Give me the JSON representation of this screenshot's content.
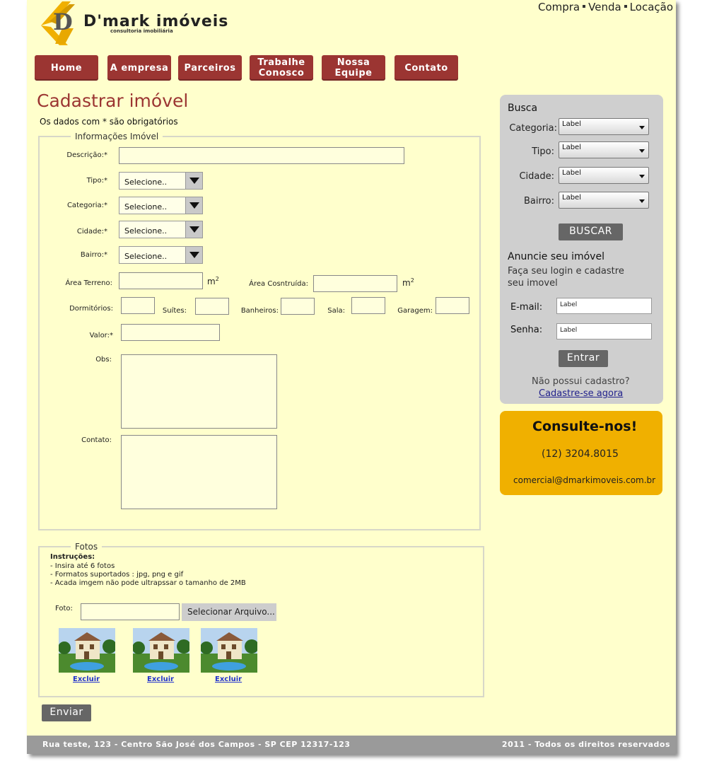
{
  "logo": {
    "name": "D'mark imóveis",
    "subtitle": "consultoria imobiliária"
  },
  "top_links": [
    "Compra",
    "Venda",
    "Locação"
  ],
  "nav": [
    "Home",
    "A empresa",
    "Parceiros",
    "Trabalhe Conosco",
    "Nossa Equipe",
    "Contato"
  ],
  "page_title": "Cadastrar imóvel",
  "required_note": "Os dados com * são obrigatórios",
  "form": {
    "legend": "Informações Imóvel",
    "descricao_label": "Descrição:*",
    "tipo_label": "Tipo:*",
    "categoria_label": "Categoria:*",
    "cidade_label": "Cidade:*",
    "bairro_label": "Bairro:*",
    "select_placeholder": "Selecione..",
    "area_terreno_label": "Área Terreno:",
    "area_construida_label": "Área Cosntruída:",
    "unit_m": "m",
    "unit_sup": "2",
    "dormitorios_label": "Dormitórios:",
    "suites_label": "Suítes:",
    "banheiros_label": "Banheiros:",
    "sala_label": "Sala:",
    "garagem_label": "Garagem:",
    "valor_label": "Valor:*",
    "obs_label": "Obs:",
    "contato_label": "Contato:"
  },
  "fotos": {
    "legend": "Fotos",
    "instructions_title": "Instruções:",
    "instructions": [
      "- Insira até 6 fotos",
      "- Formatos suportados : jpg, png e gif",
      "- Acada imgem não pode ultrapssar o tamanho de 2MB"
    ],
    "foto_label": "Foto:",
    "select_button": "Selecionar Arquivo...",
    "delete_label": "Excluir"
  },
  "submit_label": "Enviar",
  "sidebar": {
    "search_title": "Busca",
    "search_labels": [
      "Categoria:",
      "Tipo:",
      "Cidade:",
      "Bairro:"
    ],
    "select_value": "Label",
    "search_button": "BUSCAR",
    "advertise_title": "Anuncie seu imóvel",
    "advertise_text_1": "Faça seu login e cadastre",
    "advertise_text_2": "seu imovel",
    "email_label": "E-mail:",
    "password_label": "Senha:",
    "input_value": "Label",
    "login_button": "Entrar",
    "no_account": "Não possui cadastro?",
    "register_link": "Cadastre-se agora"
  },
  "consult": {
    "title": "Consulte-nos!",
    "phone": "(12) 3204.8015",
    "email": "comercial@dmarkimoveis.com.br"
  },
  "footer": {
    "address": "Rua teste, 123 - Centro São José dos Campos - SP CEP 12317-123",
    "copyright": "2011 - Todos os direitos reservados"
  },
  "colors": {
    "background": "#ffffcc",
    "accent": "#9b3532",
    "sidebar": "#cfcfcf",
    "consult": "#f0b000",
    "footer": "#9a9a9a"
  }
}
